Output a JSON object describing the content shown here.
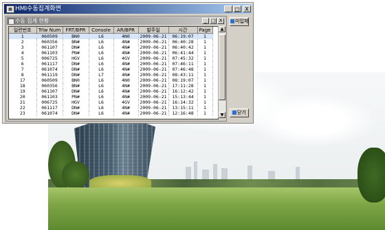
{
  "window": {
    "title": "HMI수동집계화면",
    "icon": "app-icon",
    "controls": [
      "_",
      "□",
      "X"
    ]
  },
  "child_window": {
    "title": "수동 집계 현황",
    "controls": [
      "_",
      "□",
      "X"
    ]
  },
  "grid": {
    "columns": [
      "일련번호",
      "Trlw Num",
      "FRT/BPR",
      "Console",
      "AR/BPR",
      "발주일",
      "시간",
      "Page"
    ],
    "rows": [
      [
        "1",
        "060509",
        "BN0",
        "L6",
        "4N0",
        "2009-06-21",
        "06:19:07",
        "1"
      ],
      [
        "2",
        "060356",
        "BN#",
        "L6",
        "4N#",
        "2009-06-21",
        "06:40:28",
        "1"
      ],
      [
        "3",
        "061107",
        "DN#",
        "L6",
        "4N#",
        "2009-06-21",
        "06:40:42",
        "1"
      ],
      [
        "4",
        "061103",
        "PN#",
        "L6",
        "4N#",
        "2009-06-21",
        "06:41:44",
        "1"
      ],
      [
        "5",
        "006725",
        "HGV",
        "L6",
        "4GV",
        "2009-06-21",
        "07:45:32",
        "1"
      ],
      [
        "6",
        "061117",
        "DN#",
        "L6",
        "4N#",
        "2009-06-21",
        "07:46:11",
        "1"
      ],
      [
        "7",
        "061074",
        "DN#",
        "L6",
        "4N#",
        "2009-06-21",
        "07:46:48",
        "1"
      ],
      [
        "8",
        "061119",
        "DN#",
        "L7",
        "4N#",
        "2009-06-21",
        "08:43:11",
        "1"
      ],
      [
        "17",
        "060509",
        "BN0",
        "L6",
        "4N0",
        "2009-06-21",
        "08:19:07",
        "1"
      ],
      [
        "18",
        "060356",
        "BN#",
        "L6",
        "4N#",
        "2009-06-21",
        "17:11:28",
        "1"
      ],
      [
        "19",
        "061107",
        "DN#",
        "L6",
        "4N#",
        "2009-06-21",
        "16:12:42",
        "1"
      ],
      [
        "20",
        "061103",
        "PN#",
        "L6",
        "4N#",
        "2009-06-21",
        "15:13:44",
        "1"
      ],
      [
        "21",
        "006725",
        "HGV",
        "L6",
        "4GV",
        "2009-06-21",
        "16:14:32",
        "1"
      ],
      [
        "22",
        "061117",
        "DN#",
        "L6",
        "4N#",
        "2009-06-21",
        "13:15:11",
        "1"
      ],
      [
        "23",
        "061074",
        "DN#",
        "L6",
        "4N#",
        "2009-06-21",
        "12:16:48",
        "1"
      ]
    ],
    "selected_row": 0
  },
  "buttons": {
    "print_label": "미입제",
    "close_label": "닫기"
  },
  "colors": {
    "title_active": "#0a246a",
    "title_inactive": "#7f7f7f",
    "face": "#d4d0c8"
  }
}
